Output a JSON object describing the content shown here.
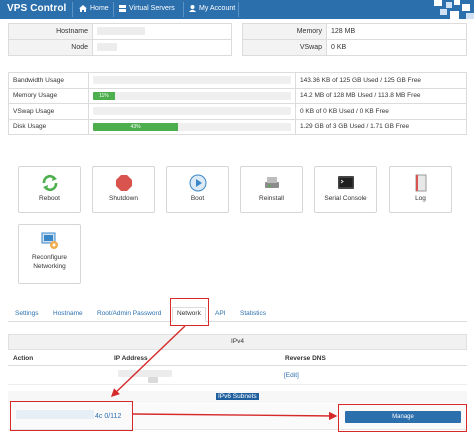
{
  "header": {
    "brand": "VPS Control",
    "nav": [
      {
        "icon": "home-icon",
        "label": "Home"
      },
      {
        "icon": "servers-icon",
        "label": "Virtual Servers"
      },
      {
        "icon": "user-icon",
        "label": "My Account"
      }
    ]
  },
  "info_left": [
    {
      "label": "Hostname",
      "value": ""
    },
    {
      "label": "Node",
      "value": ""
    }
  ],
  "info_right": [
    {
      "label": "Memory",
      "value": "128 MB"
    },
    {
      "label": "VSwap",
      "value": "0 KB"
    }
  ],
  "usage": [
    {
      "label": "Bandwidth Usage",
      "percent": 0,
      "bar_text": "",
      "text": "143.36 KB of 125 GB Used / 125 GB Free"
    },
    {
      "label": "Memory Usage",
      "percent": 11,
      "bar_text": "11%",
      "text": "14.2 MB of 128 MB Used / 113.8 MB Free"
    },
    {
      "label": "VSwap Usage",
      "percent": 0,
      "bar_text": "",
      "text": "0 KB of 0 KB Used / 0 KB Free"
    },
    {
      "label": "Disk Usage",
      "percent": 43,
      "bar_text": "43%",
      "text": "1.29 GB of 3 GB Used / 1.71 GB Free"
    }
  ],
  "actions": [
    {
      "icon": "reboot-icon",
      "label": "Reboot",
      "color": "#4cae4c"
    },
    {
      "icon": "shutdown-icon",
      "label": "Shutdown",
      "color": "#d9534f"
    },
    {
      "icon": "boot-icon",
      "label": "Boot",
      "color": "#3a87c8"
    },
    {
      "icon": "reinstall-icon",
      "label": "Reinstall",
      "color": "#888888"
    },
    {
      "icon": "serial-console-icon",
      "label": "Serial Console",
      "color": "#555555"
    },
    {
      "icon": "log-icon",
      "label": "Log",
      "color": "#999999"
    },
    {
      "icon": "reconfigure-networking-icon",
      "label": "Reconfigure Networking",
      "color": "#3a87c8"
    }
  ],
  "tabs": [
    "Settings",
    "Hostname",
    "Root/Admin Password",
    "Network",
    "API",
    "Statistics"
  ],
  "active_tab": "Network",
  "network": {
    "ipv4_heading": "IPv4",
    "columns": [
      "Action",
      "IP Address",
      "Reverse DNS"
    ],
    "rows": [
      {
        "action": "",
        "ip": "",
        "rdns_link": "[Edit]"
      }
    ],
    "ipv6_heading": "IPv6 Subnets",
    "ipv6_subnet_suffix": "4c 0/112",
    "manage_label": "Manage"
  },
  "colors": {
    "navbar": "#2b6fad",
    "progress": "#4cae4c",
    "link": "#2b6fad",
    "annotation": "#d62a2a"
  }
}
